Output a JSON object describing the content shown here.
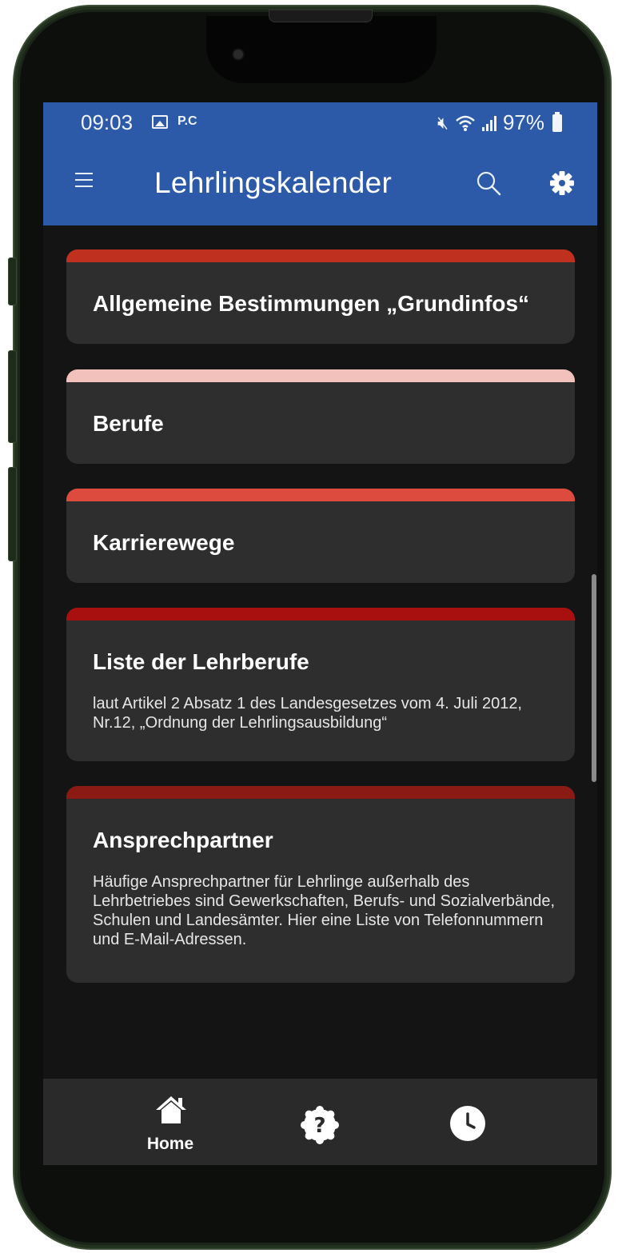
{
  "statusbar": {
    "time": "09:03",
    "carrier_badge": "P.C",
    "battery_percent": "97%"
  },
  "appbar": {
    "title": "Lehrlingskalender",
    "icons": [
      "menu-icon",
      "search-icon",
      "gear-icon"
    ]
  },
  "cards": [
    {
      "title": "Allgemeine Bestimmungen „Grundinfos“",
      "description": "",
      "accent_color": "#c0301f"
    },
    {
      "title": "Berufe",
      "description": "",
      "accent_color": "#f2c1bb"
    },
    {
      "title": "Karrierewege",
      "description": "",
      "accent_color": "#dd4b3e"
    },
    {
      "title": "Liste der Lehrberufe",
      "description": "laut Artikel 2 Absatz 1 des Landesgesetzes vom 4. Juli 2012, Nr.12, „Ordnung der Lehrlingsausbildung“",
      "accent_color": "#a8100f"
    },
    {
      "title": "Ansprechpartner",
      "description": "Häufige Ansprechpartner für Lehrlinge außerhalb des Lehrbetriebes sind Gewerkschaften, Berufs- und Sozialverbände, Schulen und Landesämter. Hier eine Liste von Telefonnummern und E-Mail-Adressen.",
      "accent_color": "#8c1a14"
    }
  ],
  "bottomnav": {
    "home_label": "Home",
    "icons": [
      "home-icon",
      "help-icon",
      "clock-icon"
    ]
  },
  "colors": {
    "brand_blue": "#2c5aa8",
    "background": "#141414",
    "card": "#2e2e2e"
  }
}
